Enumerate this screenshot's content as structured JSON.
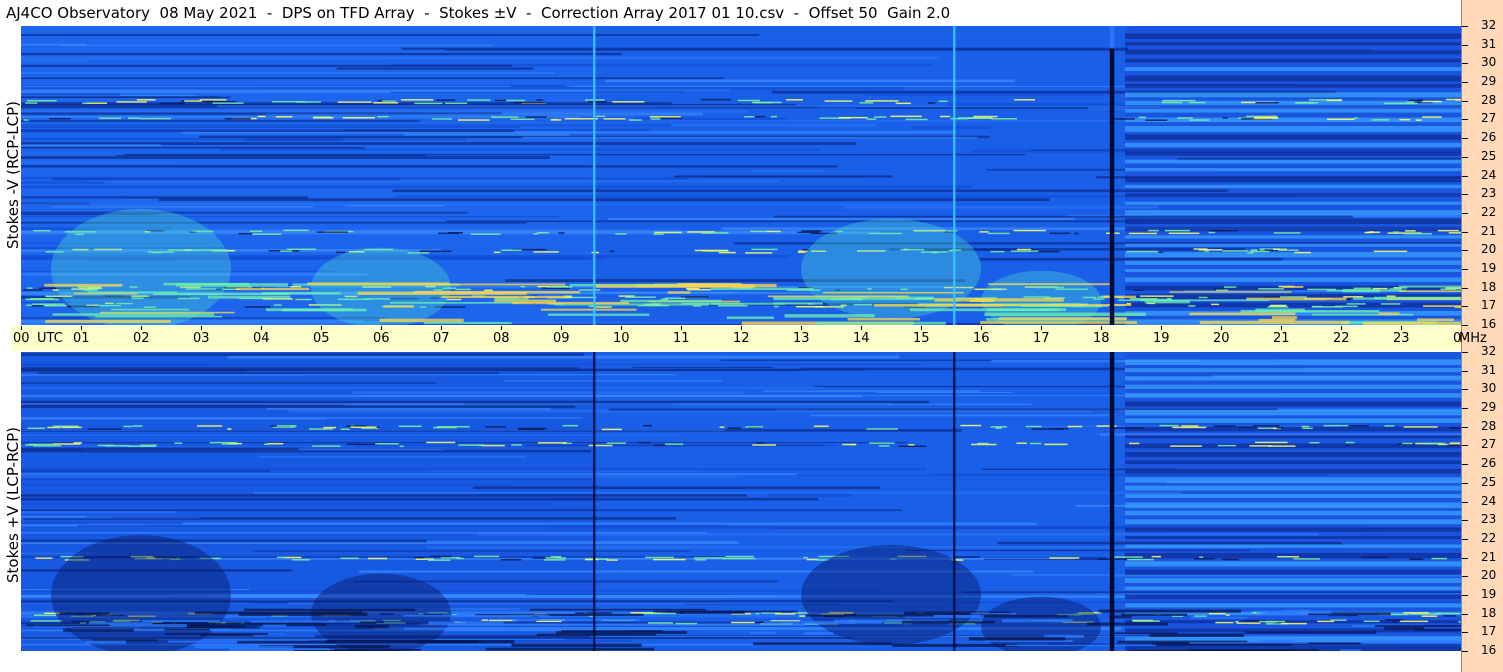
{
  "title": "AJ4CO Observatory  08 May 2021  -  DPS on TFD Array  -  Stokes ±V  -  Correction Array 2017 01 10.csv  -  Offset 50  Gain 2.0",
  "panels": {
    "top": {
      "ylabel": "Stokes -V (RCP-LCP)"
    },
    "bottom": {
      "ylabel": "Stokes +V (LCP-RCP)"
    }
  },
  "colors": {
    "background_blue": "#1a5fe8",
    "dark_band": "#0a1a60",
    "bright_green": "#7cf2a0",
    "cyan": "#35c8ff",
    "time_axis_bg": "#ffffcc",
    "freq_axis_bg": "#ffd9b8"
  },
  "chart_data": [
    {
      "type": "heatmap",
      "title": "AJ4CO Observatory  08 May 2021  -  DPS on TFD Array  -  Stokes ±V  -  Correction Array 2017 01 10.csv  -  Offset 50  Gain 2.0",
      "ylabel": "Stokes -V (RCP-LCP)",
      "x_unit": "UTC",
      "y_unit": "MHz",
      "xlim": [
        0,
        24
      ],
      "ylim": [
        16,
        32
      ],
      "x_ticks": [
        "00",
        "01",
        "02",
        "03",
        "04",
        "05",
        "06",
        "07",
        "08",
        "09",
        "10",
        "11",
        "12",
        "13",
        "14",
        "15",
        "16",
        "17",
        "18",
        "19",
        "20",
        "21",
        "22",
        "23",
        "00"
      ],
      "y_ticks": [
        16,
        17,
        18,
        19,
        20,
        21,
        22,
        23,
        24,
        25,
        26,
        27,
        28,
        29,
        30,
        31,
        32
      ],
      "vertical_lines_utc": [
        9.55,
        15.55
      ],
      "dark_column_utc": 18.18
    },
    {
      "type": "heatmap",
      "title": "",
      "ylabel": "Stokes +V (LCP-RCP)",
      "x_unit": "UTC",
      "y_unit": "MHz",
      "xlim": [
        0,
        24
      ],
      "ylim": [
        16,
        32
      ],
      "x_ticks": [
        "00",
        "01",
        "02",
        "03",
        "04",
        "05",
        "06",
        "07",
        "08",
        "09",
        "10",
        "11",
        "12",
        "13",
        "14",
        "15",
        "16",
        "17",
        "18",
        "19",
        "20",
        "21",
        "22",
        "23",
        "00"
      ],
      "y_ticks": [
        16,
        17,
        18,
        19,
        20,
        21,
        22,
        23,
        24,
        25,
        26,
        27,
        28,
        29,
        30,
        31,
        32
      ],
      "vertical_lines_utc": [
        9.55,
        15.55
      ],
      "dark_column_utc": 18.18
    }
  ],
  "time_axis": {
    "labels": [
      "00",
      "01",
      "02",
      "03",
      "04",
      "05",
      "06",
      "07",
      "08",
      "09",
      "10",
      "11",
      "12",
      "13",
      "14",
      "15",
      "16",
      "17",
      "18",
      "19",
      "20",
      "21",
      "22",
      "23",
      "00"
    ],
    "utc_label": "UTC",
    "mhz_label": "MHz"
  }
}
